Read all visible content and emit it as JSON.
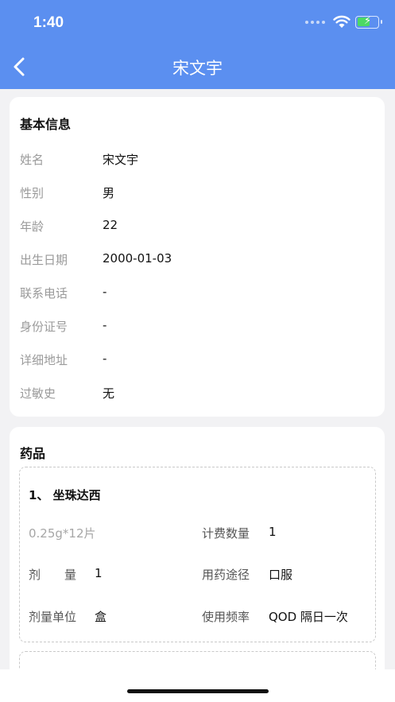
{
  "status": {
    "time": "1:40"
  },
  "nav": {
    "title": "宋文宇"
  },
  "basic_info": {
    "title": "基本信息",
    "rows": [
      {
        "label": "姓名",
        "value": "宋文宇"
      },
      {
        "label": "性别",
        "value": "男"
      },
      {
        "label": "年龄",
        "value": "22"
      },
      {
        "label": "出生日期",
        "value": "2000-01-03"
      },
      {
        "label": "联系电话",
        "value": "-"
      },
      {
        "label": "身份证号",
        "value": "-"
      },
      {
        "label": "详细地址",
        "value": "-"
      },
      {
        "label": "过敏史",
        "value": "无"
      }
    ]
  },
  "medicine": {
    "title": "药品",
    "items": [
      {
        "name": "1、 坐珠达西",
        "spec": "0.25g*12片",
        "billing_qty_label": "计费数量",
        "billing_qty": "1",
        "dose_label": "剂　　量",
        "dose": "1",
        "route_label": "用药途径",
        "route": "口服",
        "unit_label": "剂量单位",
        "unit": "盒",
        "freq_label": "使用频率",
        "freq": "QOD 隔日一次"
      }
    ]
  },
  "icons": {
    "back": "chevron-left-icon",
    "wifi": "wifi-icon",
    "battery": "battery-charging-icon",
    "signal": "cellular-signal-icon"
  },
  "colors": {
    "header": "#5b8ff0",
    "background": "#f2f2f4",
    "battery_fill": "#4cd964"
  }
}
